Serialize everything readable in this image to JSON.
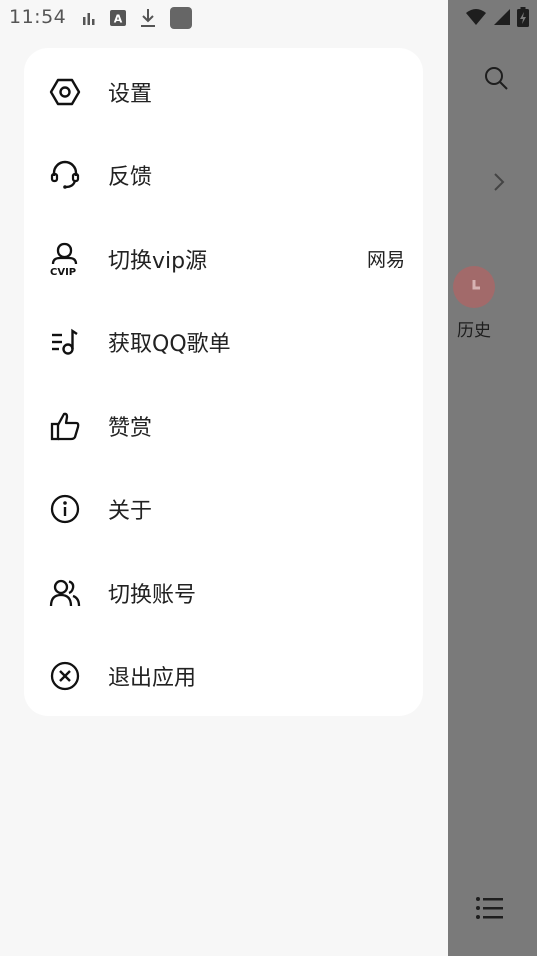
{
  "status_bar": {
    "time": "11:54"
  },
  "menu": {
    "items": [
      {
        "label": "设置",
        "icon": "settings-icon"
      },
      {
        "label": "反馈",
        "icon": "headset-icon"
      },
      {
        "label": "切换vip源",
        "icon": "vip-user-icon",
        "value": "网易"
      },
      {
        "label": "获取QQ歌单",
        "icon": "playlist-icon"
      },
      {
        "label": "赞赏",
        "icon": "thumb-up-icon"
      },
      {
        "label": "关于",
        "icon": "info-icon"
      },
      {
        "label": "切换账号",
        "icon": "switch-account-icon"
      },
      {
        "label": "退出应用",
        "icon": "exit-icon"
      }
    ]
  },
  "background": {
    "history_label": "历史",
    "accent_color": "#a26a6a"
  }
}
